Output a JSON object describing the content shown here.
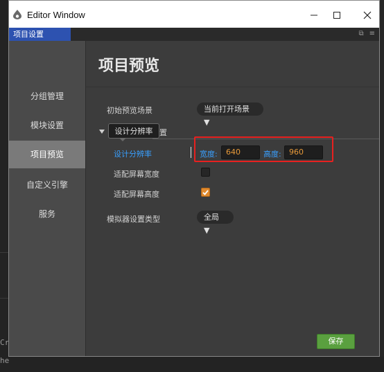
{
  "window": {
    "title": "Editor Window",
    "tab_label": "项目设置"
  },
  "sidebar": {
    "items": [
      {
        "label": "分组管理",
        "active": false
      },
      {
        "label": "模块设置",
        "active": false
      },
      {
        "label": "项目预览",
        "active": true
      },
      {
        "label": "自定义引擎",
        "active": false
      },
      {
        "label": "服务",
        "active": false
      }
    ]
  },
  "main": {
    "title": "项目预览",
    "initial_scene_label": "初始预览场景",
    "initial_scene_value": "当前打开场景 ▼",
    "section_partial_label": "置",
    "tooltip": "设计分辨率",
    "design_resolution_label": "设计分辨率",
    "width_label": "宽度:",
    "width_value": "640",
    "height_label": "高度:",
    "height_value": "960",
    "fit_width_label": "适配屏幕宽度",
    "fit_width_checked": false,
    "fit_height_label": "适配屏幕高度",
    "fit_height_checked": true,
    "simulator_type_label": "模拟器设置类型",
    "simulator_type_value": "全局 ▼",
    "save_label": "保存"
  },
  "background": {
    "lines": [
      "Cr",
      "he"
    ]
  },
  "colors": {
    "tab_blue": "#2d52b0",
    "highlight_red": "#e8201f",
    "save_green": "#5aa03f",
    "value_orange": "#e89a3a",
    "link_blue": "#39a0ff"
  }
}
